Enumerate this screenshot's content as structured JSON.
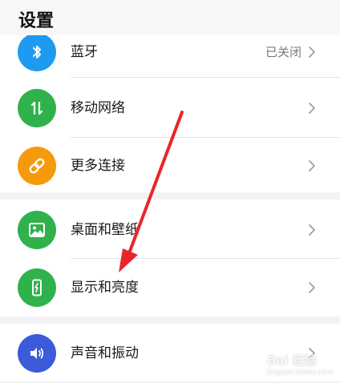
{
  "header": {
    "title": "设置"
  },
  "groups": [
    {
      "items": [
        {
          "label": "蓝牙",
          "status": "已关闭",
          "icon": "bluetooth-icon",
          "color": "#1e9bf0"
        },
        {
          "label": "移动网络",
          "icon": "mobile-data-icon",
          "color": "#2fb24c"
        },
        {
          "label": "更多连接",
          "icon": "link-icon",
          "color": "#f59a0b"
        }
      ]
    },
    {
      "items": [
        {
          "label": "桌面和壁纸",
          "icon": "wallpaper-icon",
          "color": "#2fb24c"
        },
        {
          "label": "显示和亮度",
          "icon": "display-brightness-icon",
          "color": "#2fb24c"
        }
      ]
    },
    {
      "items": [
        {
          "label": "声音和振动",
          "icon": "sound-icon",
          "color": "#3b5bdb"
        }
      ]
    }
  ],
  "annotation": {
    "arrow_color": "#e8262a"
  },
  "watermark": {
    "text": "Bai 经验",
    "sub": "jingyan.baidu.com"
  }
}
